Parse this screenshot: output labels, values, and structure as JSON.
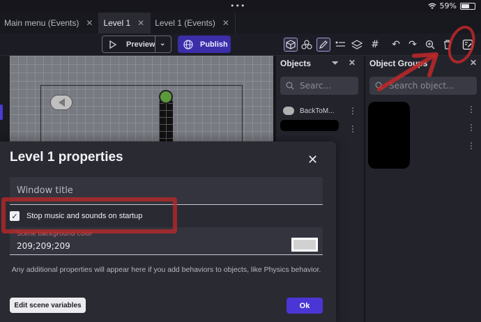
{
  "status": {
    "battery": "59%"
  },
  "tabs": [
    {
      "label": "Main menu (Events)"
    },
    {
      "label": "Level 1"
    },
    {
      "label": "Level 1 (Events)"
    }
  ],
  "toolbar": {
    "preview_label": "Preview",
    "publish_label": "Publish"
  },
  "objects_panel": {
    "title": "Objects",
    "search_placeholder": "Searc...",
    "items": [
      {
        "label": "BackToM..."
      }
    ]
  },
  "groups_panel": {
    "title": "Object Groups",
    "search_placeholder": "Search object..."
  },
  "dialog": {
    "title": "Level 1 properties",
    "window_title_placeholder": "Window title",
    "stop_music_label": "Stop music and sounds on startup",
    "stop_music_checked": true,
    "bg_color_label": "Scene background color",
    "bg_color_value": "209;209;209",
    "swatch_color": "#d1d1d1",
    "note": "Any additional properties will appear here if you add behaviors to objects, like Physics behavior.",
    "edit_vars_label": "Edit scene variables",
    "ok_label": "Ok"
  },
  "colors": {
    "accent": "#4a36d4",
    "annotation": "#c02828"
  }
}
